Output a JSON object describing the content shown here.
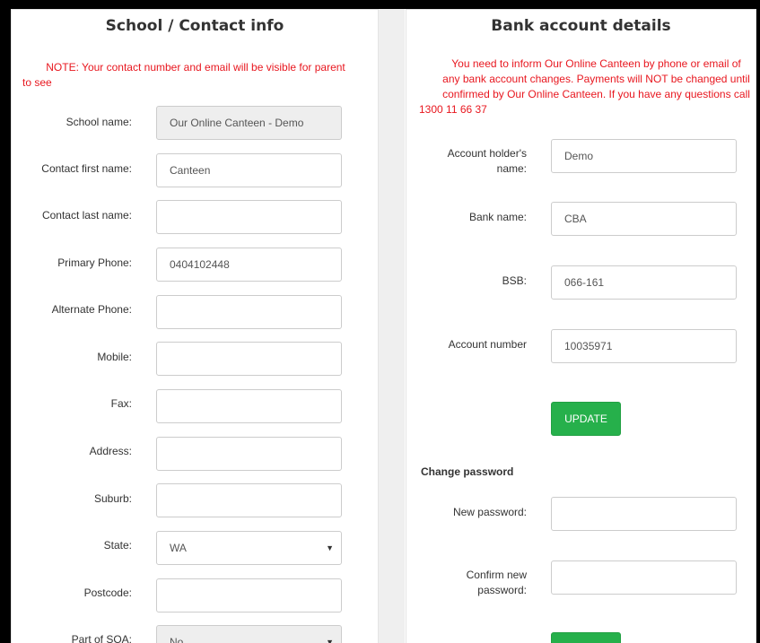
{
  "left_panel": {
    "title": "School / Contact info",
    "note_line1": "NOTE: Your contact number and email will be visible for parent",
    "note_line2": "to see",
    "fields": [
      {
        "label": "School name:",
        "value": "Our Online Canteen - Demo",
        "disabled": true
      },
      {
        "label": "Contact first name:",
        "value": "Canteen"
      },
      {
        "label": "Contact last name:",
        "value": ""
      },
      {
        "label": "Primary Phone:",
        "value": "0404102448"
      },
      {
        "label": "Alternate Phone:",
        "value": ""
      },
      {
        "label": "Mobile:",
        "value": ""
      },
      {
        "label": "Fax:",
        "value": ""
      },
      {
        "label": "Address:",
        "value": ""
      },
      {
        "label": "Suburb:",
        "value": ""
      },
      {
        "label": "State:",
        "value": "WA",
        "type": "select"
      },
      {
        "label": "Postcode:",
        "value": ""
      },
      {
        "label": "Part of SOA:",
        "value": "No",
        "type": "select",
        "disabled": true
      }
    ]
  },
  "right_panel": {
    "title": "Bank account details",
    "note_lines": [
      "You need to inform Our Online Canteen by phone or email of",
      "any bank account changes. Payments will NOT be changed until",
      "confirmed by Our Online Canteen. If you have any questions call",
      "1300 11 66 37"
    ],
    "fields": [
      {
        "label_line1": "Account holder's",
        "label_line2": "name:",
        "value": "Demo"
      },
      {
        "label_line1": "Bank name:",
        "value": "CBA"
      },
      {
        "label_line1": "BSB:",
        "value": "066-161"
      },
      {
        "label_line1": "Account number",
        "value": "10035971"
      }
    ],
    "update_label": "UPDATE",
    "password_section_title": "Change password",
    "password_fields": [
      {
        "label_line1": "New password:",
        "value": ""
      },
      {
        "label_line1": "Confirm new",
        "label_line2": "password:",
        "value": ""
      }
    ]
  },
  "colors": {
    "note_red": "#e8171f",
    "button_green": "#26b04b"
  },
  "icons": {
    "select_arrow": "chevron-down-icon"
  }
}
